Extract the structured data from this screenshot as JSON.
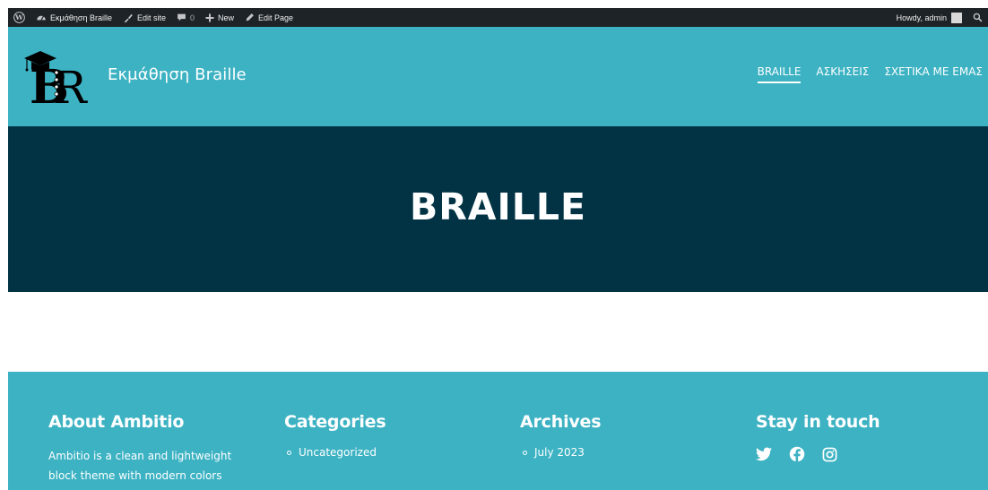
{
  "admin_bar": {
    "site_name": "Εκμάθηση Braille",
    "edit_site": "Edit site",
    "comments_count": "0",
    "new_label": "New",
    "edit_page": "Edit Page",
    "howdy": "Howdy, admin"
  },
  "header": {
    "site_title": "Εκμάθηση Braille",
    "nav": [
      {
        "label": "BRAILLE"
      },
      {
        "label": "ΑΣΚΗΣΕΙΣ"
      },
      {
        "label": "ΣΧΕΤΙΚΑ ΜΕ ΕΜΑΣ"
      }
    ]
  },
  "hero": {
    "title": "BRAILLE"
  },
  "footer": {
    "about": {
      "heading": "About Ambitio",
      "text": "Ambitio is a clean and lightweight block theme with modern colors and"
    },
    "categories": {
      "heading": "Categories",
      "items": [
        "Uncategorized"
      ]
    },
    "archives": {
      "heading": "Archives",
      "items": [
        "July 2023"
      ]
    },
    "social": {
      "heading": "Stay in touch",
      "icons": [
        "twitter-icon",
        "facebook-icon",
        "instagram-icon"
      ]
    }
  },
  "colors": {
    "admin_bar": "#1d2327",
    "header": "#3cb2c3",
    "hero": "#023344",
    "footer": "#3cb2c3"
  }
}
